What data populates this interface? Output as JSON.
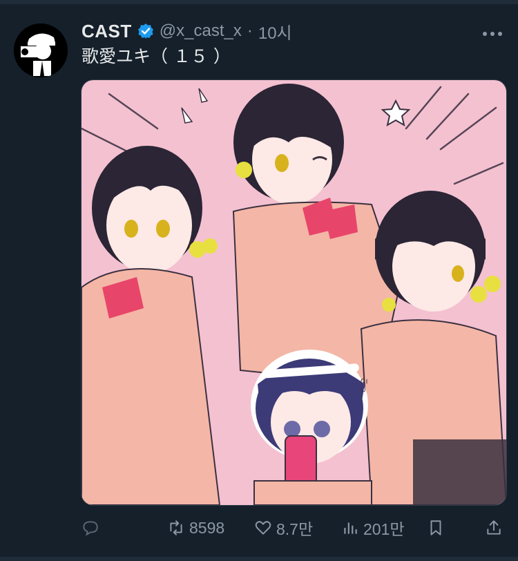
{
  "tweet": {
    "display_name": "CAST",
    "verified_icon": "verified-badge-icon",
    "handle": "@x_cast_x",
    "separator": "·",
    "time": "10시",
    "text": "歌愛ユキ（ １５ ）",
    "more_icon": "more-options-icon"
  },
  "media": {
    "image_caption": "こっ…"
  },
  "actions": {
    "reply_icon": "reply-icon",
    "retweet_count": "8598",
    "like_count": "8.7만",
    "views_count": "201만",
    "bookmark_icon": "bookmark-icon",
    "share_icon": "share-icon"
  },
  "colors": {
    "background": "#15202b",
    "text": "#e7e9ea",
    "muted": "#8b98a5",
    "verified": "#1d9bf0",
    "media_bg": "#f4c1d0"
  }
}
